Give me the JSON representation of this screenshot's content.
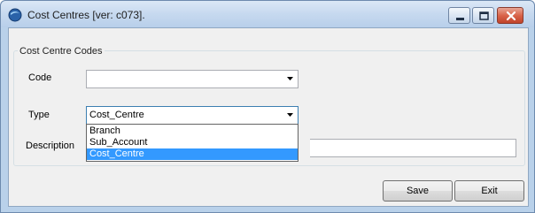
{
  "window": {
    "title": "Cost Centres [ver: c073].",
    "icons": {
      "app": "app-icon",
      "minimize": "minimize-icon",
      "maximize": "maximize-icon",
      "close": "close-icon"
    }
  },
  "form": {
    "group_title": "Cost Centre Codes",
    "code": {
      "label": "Code",
      "value": ""
    },
    "type": {
      "label": "Type",
      "value": "Cost_Centre",
      "options": [
        "Branch",
        "Sub_Account",
        "Cost_Centre"
      ],
      "selected_index": 2
    },
    "description": {
      "label": "Description",
      "value": ""
    }
  },
  "buttons": {
    "save": "Save",
    "exit": "Exit"
  },
  "colors": {
    "selection": "#3399ff",
    "titlebar": "#c6d9ef",
    "client_bg": "#f0f0f0",
    "close_button": "#d9644a"
  }
}
